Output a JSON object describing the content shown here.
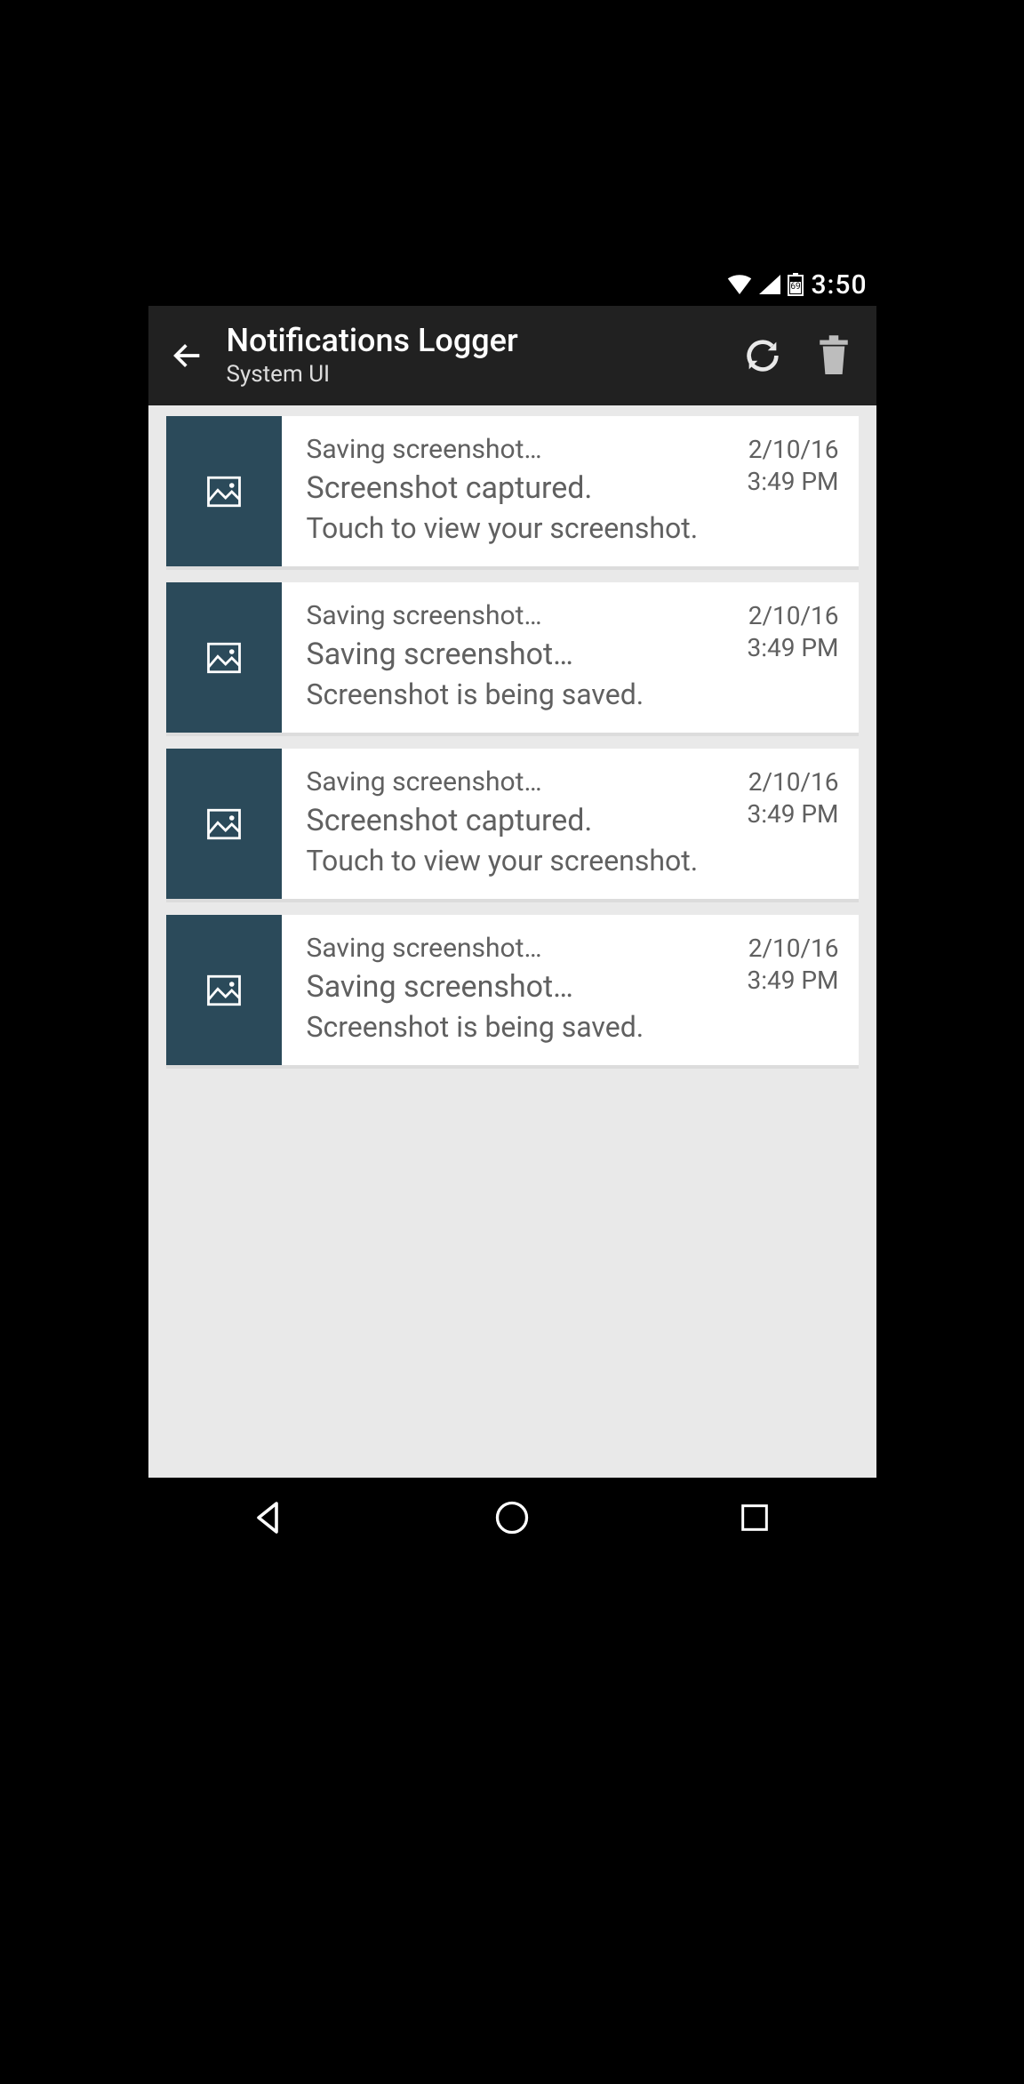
{
  "status_bar": {
    "battery_level": "69",
    "time": "3:50"
  },
  "app_bar": {
    "title": "Notifications Logger",
    "subtitle": "System UI"
  },
  "notifications": [
    {
      "line1": "Saving screenshot…",
      "line2": "Screenshot captured.",
      "line3": "Touch to view your screenshot.",
      "date": "2/10/16",
      "time": "3:49 PM"
    },
    {
      "line1": "Saving screenshot…",
      "line2": "Saving screenshot…",
      "line3": "Screenshot is being saved.",
      "date": "2/10/16",
      "time": "3:49 PM"
    },
    {
      "line1": "Saving screenshot…",
      "line2": "Screenshot captured.",
      "line3": "Touch to view your screenshot.",
      "date": "2/10/16",
      "time": "3:49 PM"
    },
    {
      "line1": "Saving screenshot…",
      "line2": "Saving screenshot…",
      "line3": "Screenshot is being saved.",
      "date": "2/10/16",
      "time": "3:49 PM"
    }
  ]
}
